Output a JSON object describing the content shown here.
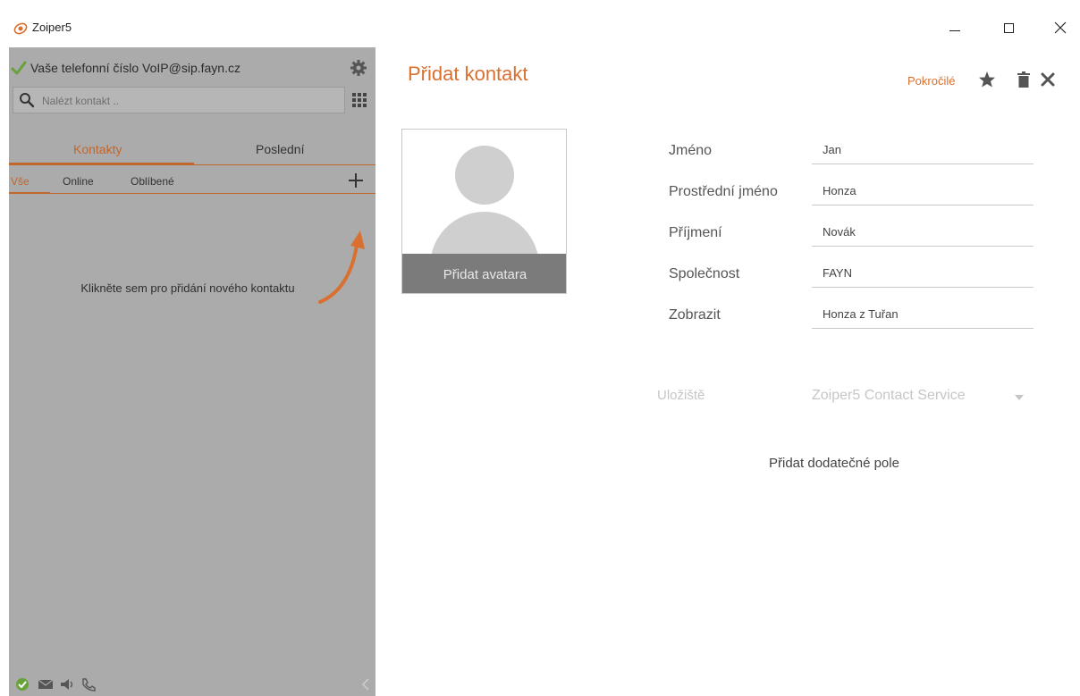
{
  "window": {
    "title": "Zoiper5",
    "min_icon": "minimize-icon",
    "max_icon": "maximize-icon",
    "close_icon": "close-icon"
  },
  "sidebar": {
    "account": {
      "status_icon": "check-icon",
      "status_color": "#67a33a",
      "label": "Vaše telefonní číslo VoIP@sip.fayn.cz",
      "settings_icon": "gear-icon"
    },
    "search": {
      "placeholder": "Nalézt kontakt ..",
      "value": ""
    },
    "tabs": [
      {
        "label": "Kontakty",
        "active": true
      },
      {
        "label": "Poslední",
        "active": false
      }
    ],
    "subtabs": [
      {
        "label": "Vše",
        "active": true
      },
      {
        "label": "Online",
        "active": false
      },
      {
        "label": "Oblíbené",
        "active": false
      }
    ],
    "empty_hint": "Klikněte sem pro přidání nového kontaktu",
    "footer_icons": [
      "status-ok-icon",
      "messages-icon",
      "volume-icon",
      "call-icon"
    ]
  },
  "main": {
    "title": "Přidat kontakt",
    "advanced_label": "Pokročilé",
    "avatar_label": "Přidat avatara",
    "fields": [
      {
        "label": "Jméno",
        "value": "Jan"
      },
      {
        "label": "Prostřední jméno",
        "value": "Honza"
      },
      {
        "label": "Příjmení",
        "value": "Novák"
      },
      {
        "label": "Společnost",
        "value": "FAYN"
      },
      {
        "label": "Zobrazit",
        "value": "Honza z Tuřan"
      }
    ],
    "storage": {
      "label": "Uložiště",
      "value": "Zoiper5 Contact Service"
    },
    "add_field_label": "Přidat dodatečné pole"
  },
  "colors": {
    "accent": "#d9702f",
    "sidebar_bg": "#ababab"
  }
}
